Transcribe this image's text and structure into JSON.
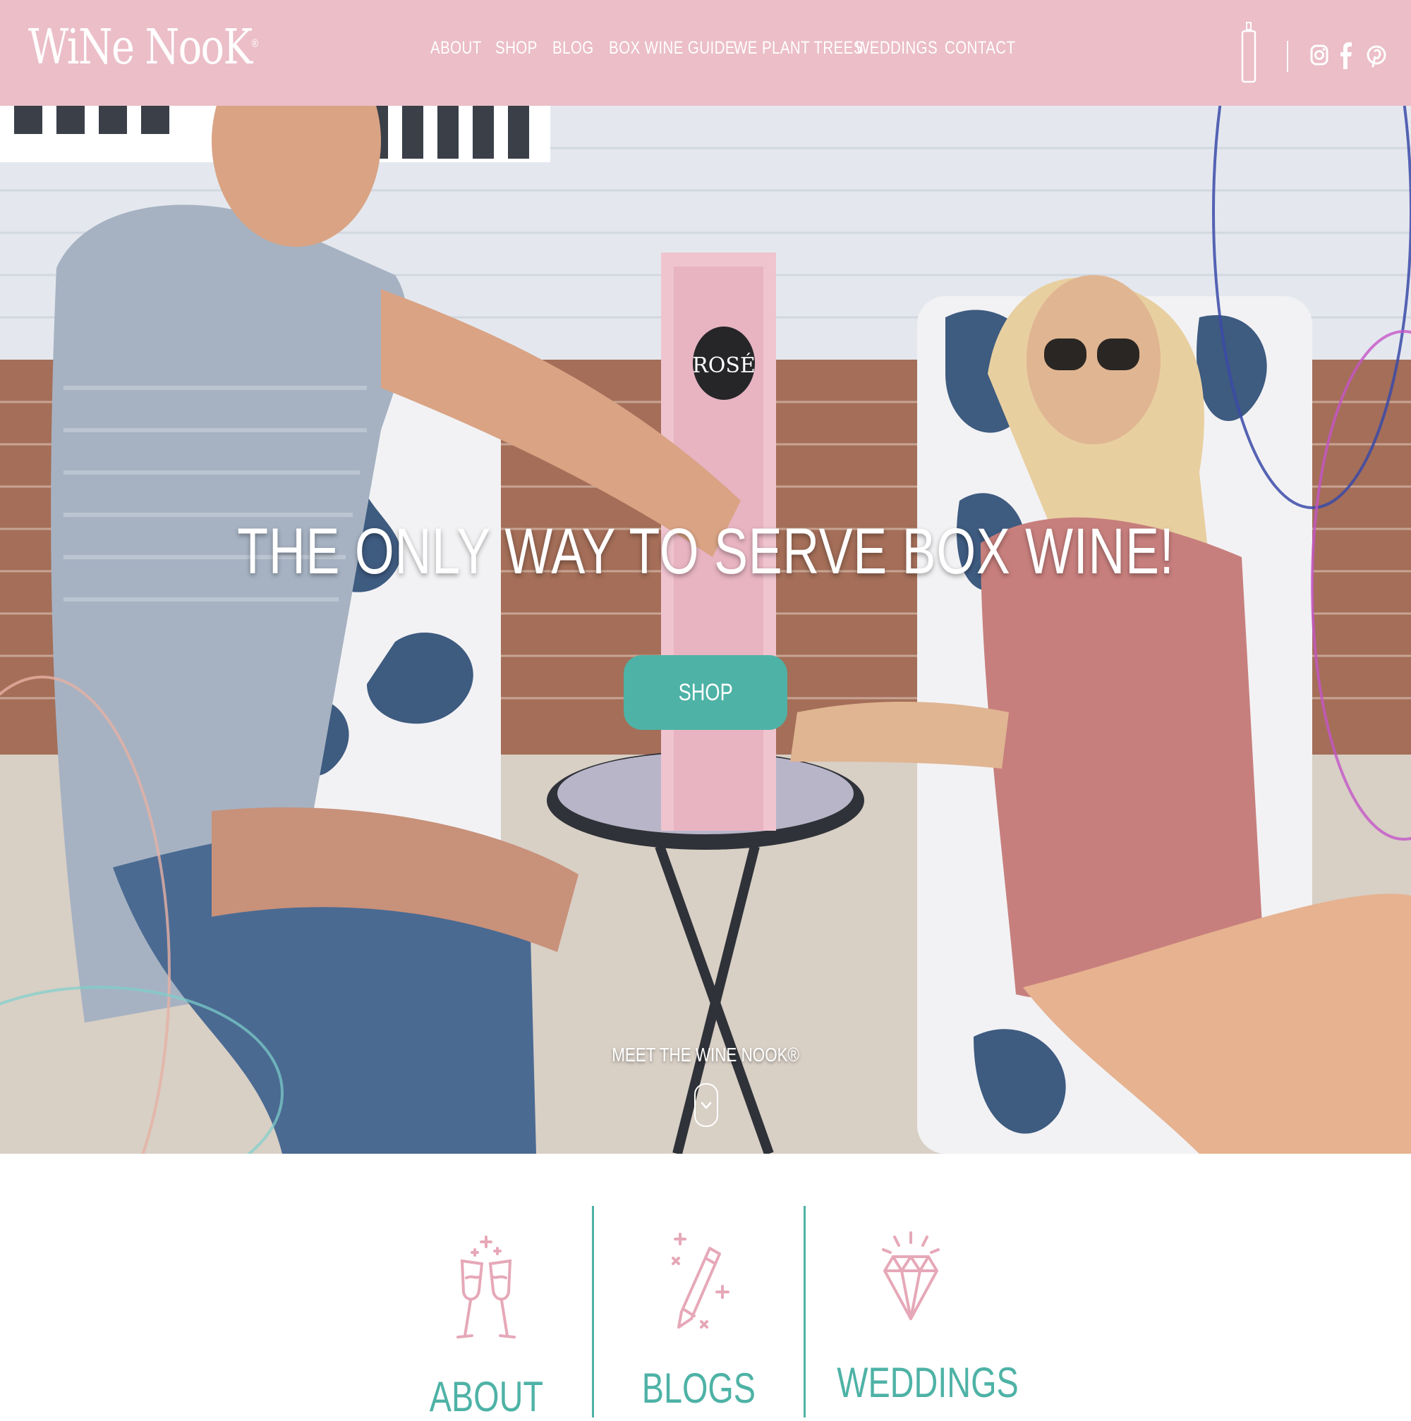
{
  "header": {
    "logo": "WiNe NooK",
    "logo_mark": "®",
    "nav": [
      "ABOUT",
      "SHOP",
      "BLOG",
      "BOX WINE GUIDE",
      "WE PLANT TREES",
      "WEDDINGS",
      "CONTACT"
    ],
    "icons": [
      "wine-bottle-icon",
      "instagram-icon",
      "facebook-icon",
      "pinterest-icon"
    ]
  },
  "hero": {
    "title": "THE ONLY WAY TO SERVE BOX WINE!",
    "shop_label": "SHOP",
    "meet_label": "MEET THE WINE NOOK®",
    "box_label": "ROSÉ"
  },
  "features": [
    {
      "label": "ABOUT",
      "icon": "wine-glasses-icon"
    },
    {
      "label": "BLOGS",
      "icon": "pencil-icon"
    },
    {
      "label": "WEDDINGS",
      "icon": "diamond-icon"
    }
  ],
  "colors": {
    "header_bg": "#ebbec8",
    "accent_teal": "#4eb2a6",
    "accent_pink": "#e6a8b8"
  }
}
